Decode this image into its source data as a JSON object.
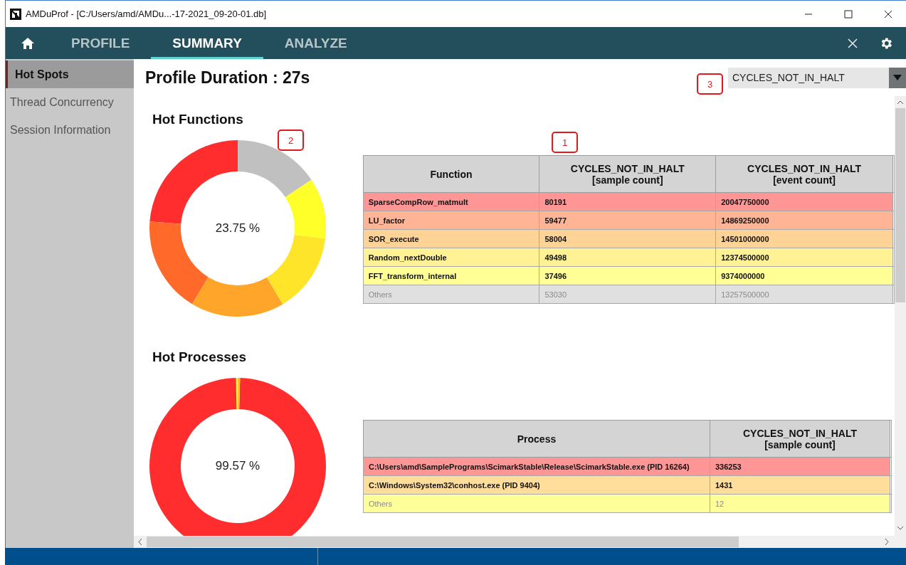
{
  "window": {
    "title": "AMDuProf - [C:/Users/amd/AMDu...-17-2021_09-20-01.db]"
  },
  "nav": {
    "tabs": [
      {
        "label": "PROFILE",
        "selected": false
      },
      {
        "label": "SUMMARY",
        "selected": true
      },
      {
        "label": "ANALYZE",
        "selected": false
      }
    ]
  },
  "sidebar": {
    "items": [
      {
        "label": "Hot Spots",
        "selected": true
      },
      {
        "label": "Thread Concurrency",
        "selected": false
      },
      {
        "label": "Session Information",
        "selected": false
      }
    ]
  },
  "heading": "Profile Duration : 27s",
  "event_select": {
    "value": "CYCLES_NOT_IN_HALT"
  },
  "callouts": [
    "1",
    "2",
    "3"
  ],
  "hot_functions": {
    "title": "Hot Functions",
    "center_label": "23.75 %",
    "slices": [
      {
        "color": "#ff2d2d"
      },
      {
        "color": "#ff6a2a"
      },
      {
        "color": "#ffa62a"
      },
      {
        "color": "#ffe52a"
      },
      {
        "color": "#ffff2a"
      },
      {
        "color": "#c0c0c0"
      }
    ],
    "columns": [
      {
        "title": "Function"
      },
      {
        "title": "CYCLES_NOT_IN_HALT",
        "subtitle": "[sample count]"
      },
      {
        "title": "CYCLES_NOT_IN_HALT",
        "subtitle": "[event count]"
      }
    ],
    "rows": [
      {
        "kind": "item",
        "cells": [
          "SparseCompRow_matmult",
          "80191",
          "20047750000"
        ]
      },
      {
        "kind": "item",
        "cells": [
          "LU_factor",
          "59477",
          "14869250000"
        ]
      },
      {
        "kind": "item",
        "cells": [
          "SOR_execute",
          "58004",
          "14501000000"
        ]
      },
      {
        "kind": "item",
        "cells": [
          "Random_nextDouble",
          "49498",
          "12374500000"
        ]
      },
      {
        "kind": "item",
        "cells": [
          "FFT_transform_internal",
          "37496",
          "9374000000"
        ]
      },
      {
        "kind": "other",
        "cells": [
          "Others",
          "53030",
          "13257500000"
        ]
      }
    ]
  },
  "hot_processes": {
    "title": "Hot Processes",
    "center_label": "99.57 %",
    "slices": [
      {
        "color": "#ff2d2d"
      },
      {
        "color": "#ffbb35"
      },
      {
        "color": "#ffff35"
      }
    ],
    "columns": [
      {
        "title": "Process"
      },
      {
        "title": "CYCLES_NOT_IN_HALT",
        "subtitle": "[sample count]"
      }
    ],
    "rows": [
      {
        "kind": "item",
        "cells": [
          "C:\\Users\\amd\\SamplePrograms\\ScimarkStable\\Release\\ScimarkStable.exe (PID 16264)",
          "336253"
        ]
      },
      {
        "kind": "item",
        "cells": [
          "C:\\Windows\\System32\\conhost.exe (PID 9404)",
          "1431"
        ]
      },
      {
        "kind": "other",
        "cells": [
          "Others",
          "12"
        ]
      }
    ]
  }
}
